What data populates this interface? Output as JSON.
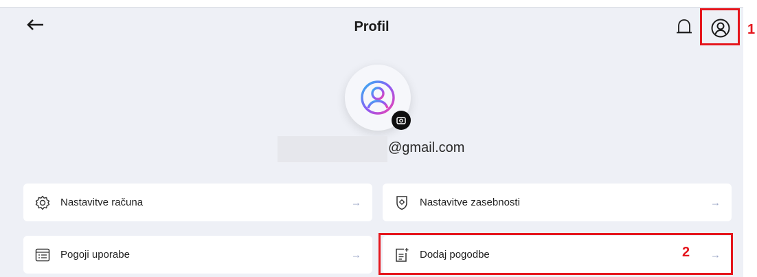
{
  "header": {
    "title": "Profil"
  },
  "profile": {
    "email_suffix": "@gmail.com"
  },
  "menu": [
    {
      "label": "Nastavitve računa",
      "icon": "gear-icon",
      "arrow": "→"
    },
    {
      "label": "Nastavitve zasebnosti",
      "icon": "shield-icon",
      "arrow": "→"
    },
    {
      "label": "Pogoji uporabe",
      "icon": "document-list-icon",
      "arrow": "→"
    },
    {
      "label": "Dodaj pogodbe",
      "icon": "add-document-icon",
      "arrow": "→"
    }
  ],
  "annotations": {
    "marker_1": "1",
    "marker_2": "2"
  },
  "colors": {
    "background": "#eef0f6",
    "card": "#ffffff",
    "highlight": "#e5161d",
    "arrow": "#9aa6c6"
  }
}
